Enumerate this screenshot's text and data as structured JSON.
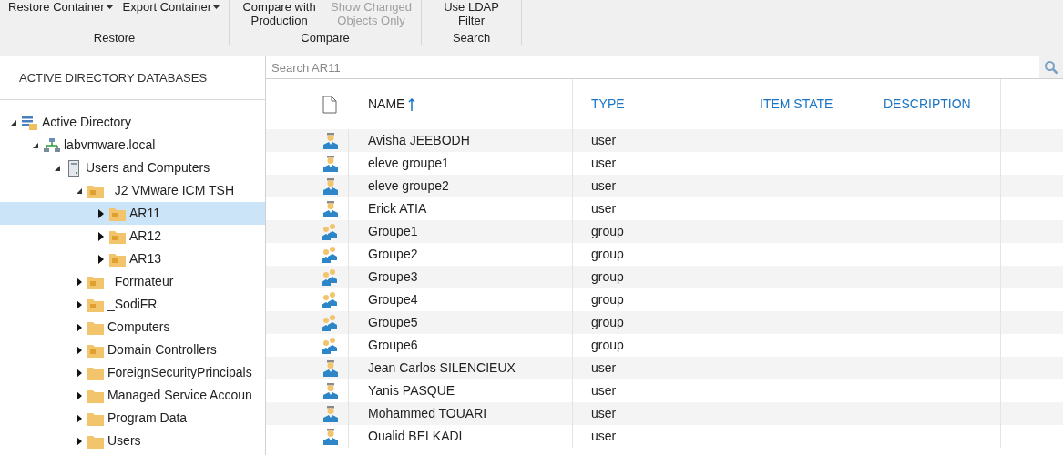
{
  "ribbon": {
    "groups": [
      {
        "label": "Restore",
        "buttons": [
          {
            "label": "Restore Container",
            "dropdown": true,
            "disabled": false
          },
          {
            "label": "Export Container",
            "dropdown": true,
            "disabled": false
          }
        ]
      },
      {
        "label": "Compare",
        "buttons": [
          {
            "label": "Compare with Production",
            "dropdown": false,
            "disabled": false
          },
          {
            "label": "Show Changed Objects Only",
            "dropdown": false,
            "disabled": true
          }
        ]
      },
      {
        "label": "Search",
        "buttons": [
          {
            "label": "Use LDAP Filter",
            "dropdown": false,
            "disabled": false
          }
        ]
      }
    ]
  },
  "sidebar": {
    "title": "ACTIVE DIRECTORY DATABASES",
    "tree": [
      {
        "label": "Active Directory",
        "kind": "directory",
        "expanded": true,
        "selected": false,
        "children": [
          {
            "label": "labvmware.local",
            "kind": "domain",
            "expanded": true,
            "selected": false,
            "children": [
              {
                "label": "Users and Computers",
                "kind": "server",
                "expanded": true,
                "selected": false,
                "children": [
                  {
                    "label": "_J2 VMware ICM TSH",
                    "kind": "ou",
                    "expanded": true,
                    "selected": false,
                    "children": [
                      {
                        "label": "AR11",
                        "kind": "ou",
                        "expanded": false,
                        "selected": true
                      },
                      {
                        "label": "AR12",
                        "kind": "ou",
                        "expanded": false,
                        "selected": false
                      },
                      {
                        "label": "AR13",
                        "kind": "ou",
                        "expanded": false,
                        "selected": false
                      }
                    ]
                  },
                  {
                    "label": "_Formateur",
                    "kind": "ou",
                    "expanded": false,
                    "selected": false
                  },
                  {
                    "label": "_SodiFR",
                    "kind": "ou",
                    "expanded": false,
                    "selected": false
                  },
                  {
                    "label": "Computers",
                    "kind": "folder",
                    "expanded": false,
                    "selected": false
                  },
                  {
                    "label": "Domain Controllers",
                    "kind": "ou",
                    "expanded": false,
                    "selected": false
                  },
                  {
                    "label": "ForeignSecurityPrincipals",
                    "kind": "folder",
                    "expanded": false,
                    "selected": false
                  },
                  {
                    "label": "Managed Service Accoun",
                    "kind": "folder",
                    "expanded": false,
                    "selected": false
                  },
                  {
                    "label": "Program Data",
                    "kind": "folder",
                    "expanded": false,
                    "selected": false
                  },
                  {
                    "label": "Users",
                    "kind": "folder",
                    "expanded": false,
                    "selected": false
                  }
                ]
              }
            ]
          }
        ]
      }
    ]
  },
  "search": {
    "placeholder": "Search AR11"
  },
  "table": {
    "columns": [
      {
        "label": "NAME",
        "sorted": true
      },
      {
        "label": "TYPE",
        "sorted": false
      },
      {
        "label": "ITEM STATE",
        "sorted": false
      },
      {
        "label": "DESCRIPTION",
        "sorted": false
      }
    ],
    "rows": [
      {
        "kind": "user",
        "name": "Avisha JEEBODH",
        "type": "user"
      },
      {
        "kind": "user",
        "name": "eleve groupe1",
        "type": "user"
      },
      {
        "kind": "user",
        "name": "eleve groupe2",
        "type": "user"
      },
      {
        "kind": "user",
        "name": "Erick ATIA",
        "type": "user"
      },
      {
        "kind": "group",
        "name": "Groupe1",
        "type": "group"
      },
      {
        "kind": "group",
        "name": "Groupe2",
        "type": "group"
      },
      {
        "kind": "group",
        "name": "Groupe3",
        "type": "group"
      },
      {
        "kind": "group",
        "name": "Groupe4",
        "type": "group"
      },
      {
        "kind": "group",
        "name": "Groupe5",
        "type": "group"
      },
      {
        "kind": "group",
        "name": "Groupe6",
        "type": "group"
      },
      {
        "kind": "user",
        "name": "Jean Carlos SILENCIEUX",
        "type": "user"
      },
      {
        "kind": "user",
        "name": "Yanis PASQUE",
        "type": "user"
      },
      {
        "kind": "user",
        "name": "Mohammed TOUARI",
        "type": "user"
      },
      {
        "kind": "user",
        "name": "Oualid BELKADI",
        "type": "user"
      }
    ]
  }
}
